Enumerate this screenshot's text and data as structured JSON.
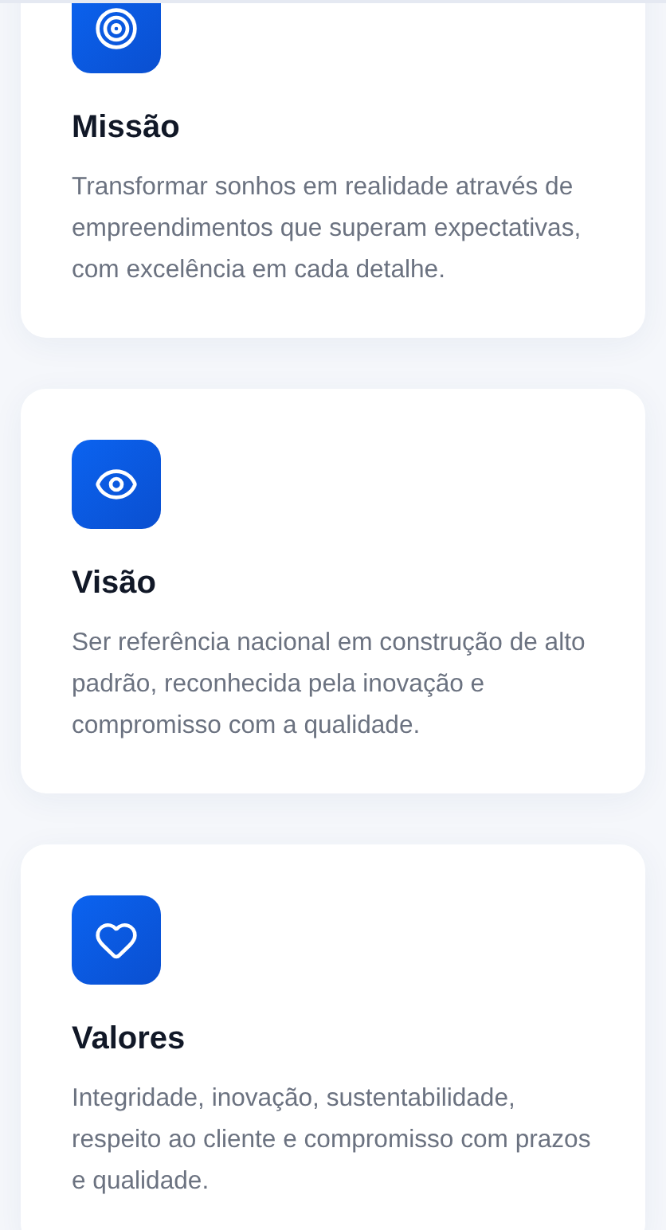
{
  "cards": [
    {
      "kind": "target",
      "title": "Missão",
      "text": "Transformar sonhos em realidade através de empreendimentos que superam expectativas, com excelência em cada detalhe."
    },
    {
      "kind": "eye",
      "title": "Visão",
      "text": "Ser referência nacional em construção de alto padrão, reconhecida pela inovação e compromisso com a qualidade."
    },
    {
      "kind": "heart",
      "title": "Valores",
      "text": "Integridade, inovação, sustentabilidade, respeito ao cliente e compromisso com prazos e qualidade."
    }
  ]
}
